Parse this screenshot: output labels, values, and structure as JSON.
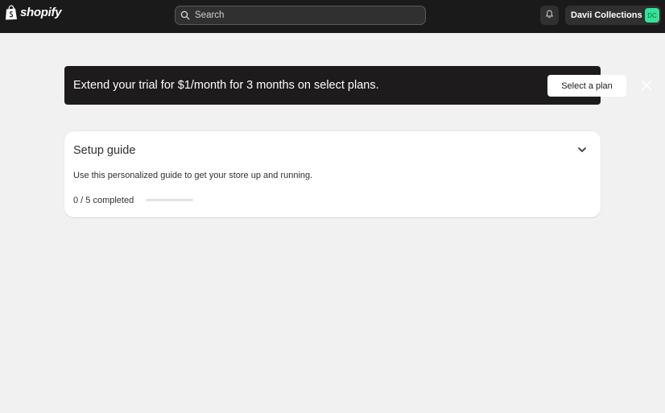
{
  "topbar": {
    "logo_text": "shopify",
    "logo_icon": "shopping-bag-icon",
    "search": {
      "placeholder": "Search",
      "value": ""
    },
    "notifications_icon": "bell-icon",
    "store": {
      "name": "Davii Collections",
      "initials": "DC",
      "avatar_color": "#36e29a"
    }
  },
  "banner": {
    "text": "Extend your trial for $1/month for 3 months on select plans.",
    "button_label": "Select a plan",
    "close_icon": "close-icon"
  },
  "setup_guide": {
    "title": "Setup guide",
    "description": "Use this personalized guide to get your store up and running.",
    "progress_text": "0 / 5 completed",
    "completed": 0,
    "total": 5,
    "toggle_icon": "chevron-down-icon"
  }
}
